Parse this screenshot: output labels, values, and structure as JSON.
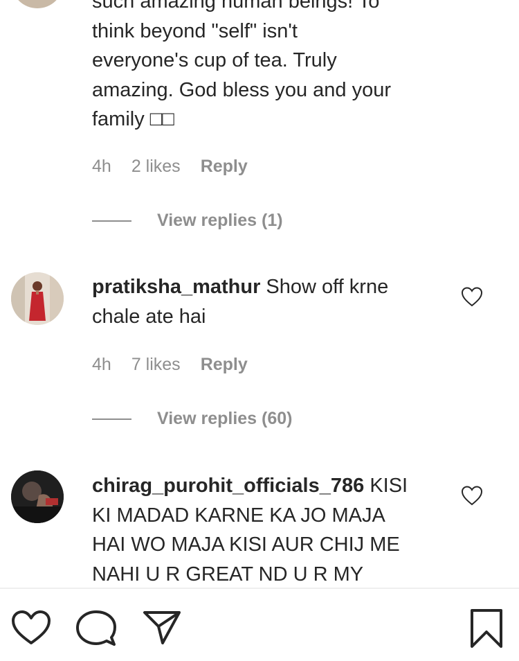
{
  "comments": [
    {
      "username": "",
      "text_lines": [
        "such amazing human beings! To",
        "think beyond \"self\" isn't",
        "everyone's cup of tea. Truly",
        "amazing. God bless you and your",
        "family □□"
      ],
      "time": "4h",
      "likes": "2 likes",
      "reply_label": "Reply",
      "view_replies": "View replies (1)"
    },
    {
      "username": "pratiksha_mathur",
      "text_lines": [
        "Show off krne",
        "chale ate hai"
      ],
      "time": "4h",
      "likes": "7 likes",
      "reply_label": "Reply",
      "view_replies": "View replies (60)"
    },
    {
      "username": "chirag_purohit_officials_786",
      "text_lines": [
        "KISI",
        "KI MADAD KARNE KA JO MAJA",
        "HAI WO MAJA KISI AUR CHIJ ME",
        "NAHI U R GREAT ND U R MY"
      ]
    }
  ],
  "icons": {
    "like": "heart-icon",
    "comment": "comment-icon",
    "share": "share-icon",
    "save": "bookmark-icon"
  },
  "colors": {
    "text": "#262626",
    "secondary": "#8e8e8e",
    "divider": "#efefef"
  }
}
